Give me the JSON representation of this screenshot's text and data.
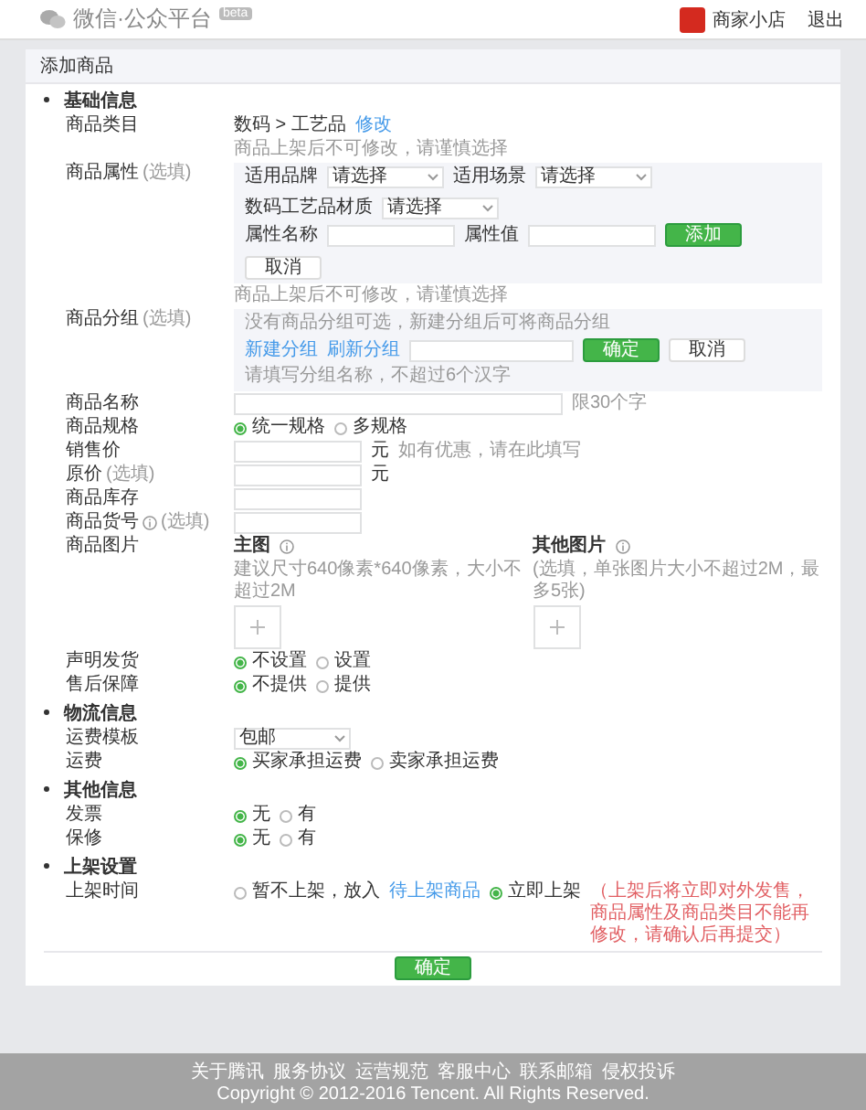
{
  "header": {
    "logo_text": "微信·公众平台",
    "badge": "beta",
    "account_name": "商家小店",
    "logout": "退出"
  },
  "card_title": "添加商品",
  "sections": [
    {
      "title": "基础信息",
      "fields": [
        {
          "kind": "category",
          "label": "商品类目",
          "value": "数码 > 工艺品",
          "link": "修改",
          "hint": "商品上架后不可修改，请谨慎选择"
        },
        {
          "kind": "attributes",
          "label": "商品属性",
          "optional": "(选填)",
          "selects": [
            {
              "label": "适用品牌",
              "value": "请选择"
            },
            {
              "label": "适用场景",
              "value": "请选择"
            },
            {
              "label": "数码工艺品材质",
              "value": "请选择"
            }
          ],
          "name_label": "属性名称",
          "value_label": "属性值",
          "add": "添加",
          "cancel": "取消",
          "hint": "商品上架后不可修改，请谨慎选择"
        },
        {
          "kind": "group",
          "label": "商品分组",
          "optional": "(选填)",
          "note": "没有商品分组可选，新建分组后可将商品分组",
          "links": [
            "新建分组",
            "刷新分组"
          ],
          "confirm": "确定",
          "cancel": "取消",
          "hint": "请填写分组名称，不超过6个汉字"
        },
        {
          "kind": "input",
          "label": "商品名称",
          "wide": true,
          "hint": "限30个字"
        },
        {
          "kind": "radio",
          "label": "商品规格",
          "options": [
            {
              "label": "统一规格",
              "selected": true
            },
            {
              "label": "多规格",
              "selected": false
            }
          ]
        },
        {
          "kind": "input",
          "label": "销售价",
          "unit": "元",
          "hint": "如有优惠，请在此填写"
        },
        {
          "kind": "input",
          "label": "原价",
          "optional": "(选填)",
          "unit": "元"
        },
        {
          "kind": "input",
          "label": "商品库存"
        },
        {
          "kind": "input",
          "label": "商品货号",
          "info": true,
          "optional": "(选填)"
        },
        {
          "kind": "images",
          "label": "商品图片",
          "items": [
            {
              "title": "主图",
              "note": "建议尺寸640像素*640像素，大小不超过2M",
              "info": true
            },
            {
              "title": "其他图片",
              "note": "(选填，单张图片大小不超过2M，最多5张)",
              "info": true
            }
          ]
        },
        {
          "kind": "radio",
          "label": "声明发货",
          "options": [
            {
              "label": "不设置",
              "selected": true
            },
            {
              "label": "设置",
              "selected": false
            }
          ]
        },
        {
          "kind": "radio",
          "label": "售后保障",
          "options": [
            {
              "label": "不提供",
              "selected": true
            },
            {
              "label": "提供",
              "selected": false
            }
          ]
        }
      ]
    },
    {
      "title": "物流信息",
      "fields": [
        {
          "kind": "select",
          "label": "运费模板",
          "value": "包邮"
        },
        {
          "kind": "radio",
          "label": "运费",
          "options": [
            {
              "label": "买家承担运费",
              "selected": true
            },
            {
              "label": "卖家承担运费",
              "selected": false
            }
          ]
        }
      ]
    },
    {
      "title": "其他信息",
      "fields": [
        {
          "kind": "radio",
          "label": "发票",
          "options": [
            {
              "label": "无",
              "selected": true
            },
            {
              "label": "有",
              "selected": false
            }
          ]
        },
        {
          "kind": "radio",
          "label": "保修",
          "options": [
            {
              "label": "无",
              "selected": true
            },
            {
              "label": "有",
              "selected": false
            }
          ]
        }
      ]
    },
    {
      "title": "上架设置",
      "fields": [
        {
          "kind": "radio",
          "label": "上架时间",
          "options": [
            {
              "label": "暂不上架，放入",
              "link": "待上架商品",
              "selected": false
            },
            {
              "label": "立即上架",
              "note": "（上架后将立即对外发售，商品属性及商品类目不能再修改，请确认后再提交）",
              "selected": true
            }
          ]
        }
      ]
    }
  ],
  "submit": "确定",
  "footer": {
    "links": [
      "关于腾讯",
      "服务协议",
      "运营规范",
      "客服中心",
      "联系邮箱",
      "侵权投诉"
    ],
    "copyright": "Copyright © 2012-2016 Tencent. All Rights Reserved."
  }
}
